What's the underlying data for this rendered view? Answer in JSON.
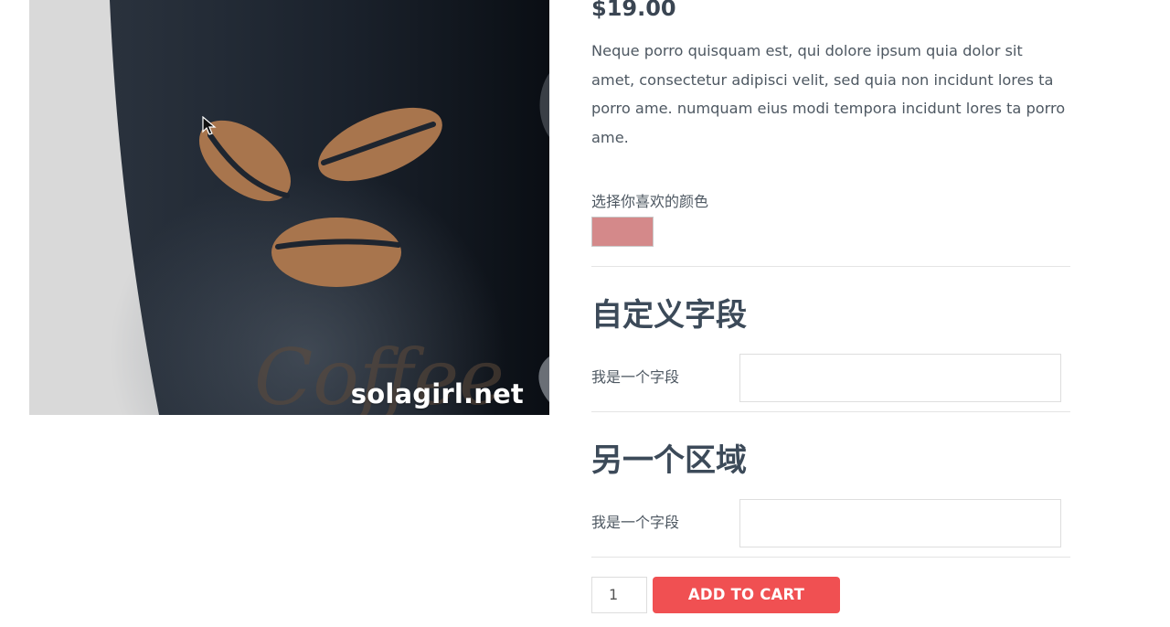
{
  "product": {
    "price": "$19.00",
    "description": "Neque porro quisquam est, qui dolore ipsum quia dolor sit amet, consectetur adipisci velit, sed quia non incidunt lores ta porro ame. numquam eius modi tempora incidunt lores ta porro ame.",
    "image": {
      "watermark": "solagirl.net",
      "cup_text": "Coffee"
    }
  },
  "color_picker": {
    "label": "选择你喜欢的颜色",
    "swatch_color": "#d4898a"
  },
  "sections": [
    {
      "title": "自定义字段",
      "field_label": "我是一个字段",
      "field_value": ""
    },
    {
      "title": "另一个区域",
      "field_label": "我是一个字段",
      "field_value": ""
    }
  ],
  "cart": {
    "quantity": "1",
    "button_label": "ADD TO CART",
    "button_color": "#f05052"
  },
  "icons": {
    "cursor": "mouse-pointer-icon"
  }
}
